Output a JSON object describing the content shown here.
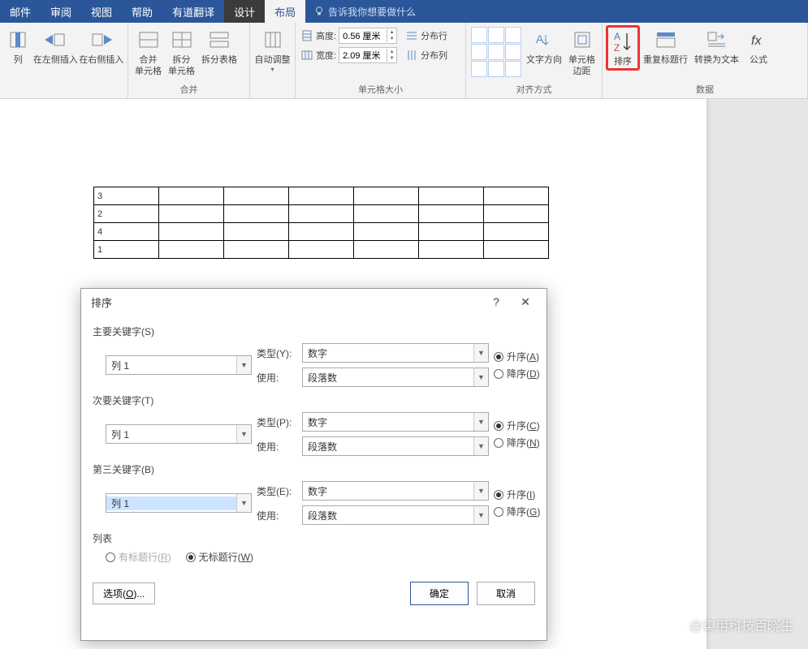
{
  "tabs": {
    "mail": "邮件",
    "review": "审阅",
    "view": "视图",
    "help": "帮助",
    "youdao": "有道翻译",
    "design": "设计",
    "layout": "布局"
  },
  "tell_me": "告诉我你想要做什么",
  "ribbon": {
    "insert_col": "列",
    "insert_left": "在左侧插入",
    "insert_right": "在右侧插入",
    "merge_cells": "合并\n单元格",
    "split_cells": "拆分\n单元格",
    "split_table": "拆分表格",
    "merge_group": "合并",
    "autofit": "自动调整",
    "height": "高度:",
    "height_val": "0.56 厘米",
    "width": "宽度:",
    "width_val": "2.09 厘米",
    "dist_rows": "分布行",
    "dist_cols": "分布列",
    "cellsize_group": "单元格大小",
    "text_dir": "文字方向",
    "cell_margin": "单元格\n边距",
    "align_group": "对齐方式",
    "sort": "排序",
    "repeat_header": "重复标题行",
    "convert_text": "转换为文本",
    "formula": "公式",
    "data_group": "数据"
  },
  "table_rows": [
    "3",
    "2",
    "4",
    "1"
  ],
  "dialog": {
    "title": "排序",
    "primary": "主要关键字(S)",
    "secondary": "次要关键字(T)",
    "tertiary": "第三关键字(B)",
    "col1": "列 1",
    "type": "类型(Y):",
    "type_p": "类型(P):",
    "type_e": "类型(E):",
    "use": "使用:",
    "type_val": "数字",
    "use_val": "段落数",
    "asc_a": "升序(A)",
    "desc_d": "降序(D)",
    "asc_c": "升序(C)",
    "desc_n": "降序(N)",
    "asc_i": "升序(I)",
    "desc_g": "降序(G)",
    "list": "列表",
    "has_header": "有标题行(R)",
    "no_header": "无标题行(W)",
    "options": "选项(O)...",
    "ok": "确定",
    "cancel": "取消"
  },
  "watermark": "@实用科技百晓生"
}
